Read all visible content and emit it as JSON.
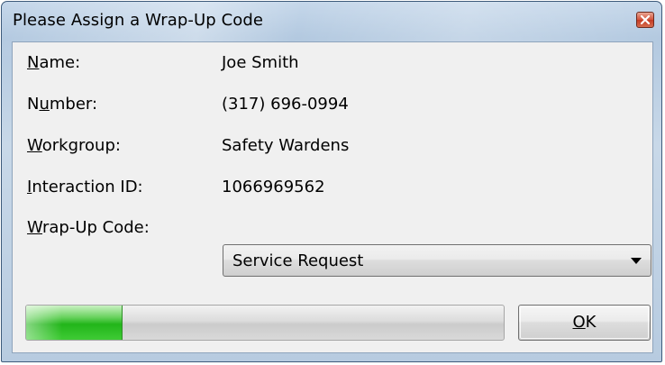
{
  "window": {
    "title": "Please Assign a Wrap-Up Code",
    "close_icon": "close-icon"
  },
  "fields": {
    "name": {
      "label": "Name:",
      "mnemonic": "N",
      "label_rest": "ame:",
      "value": "Joe Smith"
    },
    "number": {
      "label": "Number:",
      "label_pre": "N",
      "mnemonic": "u",
      "label_rest": "mber:",
      "value": "(317) 696-0994"
    },
    "workgroup": {
      "label": "Workgroup:",
      "mnemonic": "W",
      "label_rest": "orkgroup:",
      "value": "Safety Wardens"
    },
    "interaction_id": {
      "label": "Interaction ID:",
      "mnemonic": "I",
      "label_rest": "nteraction ID:",
      "value": "1066969562"
    },
    "wrap_up_code": {
      "label": "Wrap-Up Code:",
      "mnemonic": "W",
      "label_rest": "rap-Up Code:",
      "selected": "Service Request"
    }
  },
  "progress": {
    "fraction": 0.2
  },
  "buttons": {
    "ok": {
      "label": "OK",
      "mnemonic": "O",
      "label_rest": "K"
    }
  },
  "colors": {
    "progress_fill": "#22b51a",
    "close_button": "#c43a22"
  }
}
